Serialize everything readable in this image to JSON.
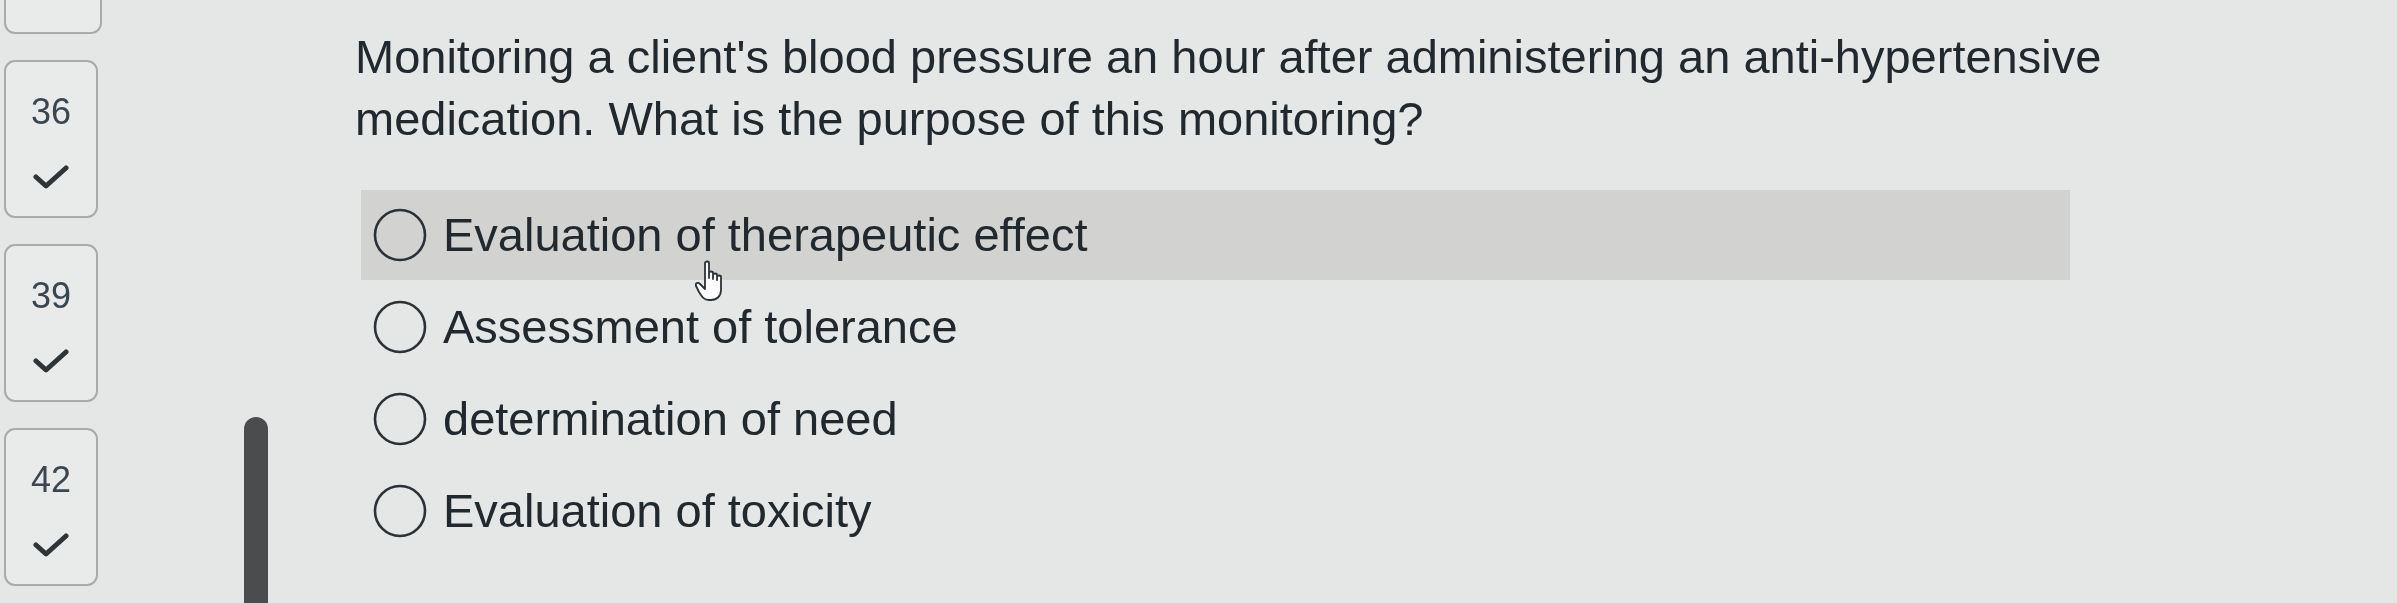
{
  "question_nav": {
    "items": [
      {
        "number": "36",
        "answered": true
      },
      {
        "number": "39",
        "answered": true
      },
      {
        "number": "42",
        "answered": true
      }
    ]
  },
  "question": {
    "text": "Monitoring a client's blood pressure an hour after administering an anti-hypertensive medication. What is the purpose of this monitoring?"
  },
  "options": [
    {
      "label": "Evaluation of therapeutic effect",
      "selected": false,
      "hovered": true
    },
    {
      "label": "Assessment of tolerance",
      "selected": false,
      "hovered": false
    },
    {
      "label": "determination of need",
      "selected": false,
      "hovered": false
    },
    {
      "label": "Evaluation of toxicity",
      "selected": false,
      "hovered": false
    }
  ]
}
